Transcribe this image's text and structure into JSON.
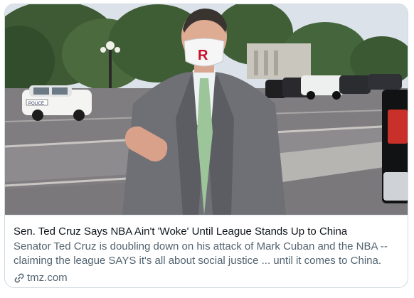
{
  "link_card": {
    "headline": "Sen. Ted Cruz Says NBA Ain't 'Woke' Until League Stands Up to China",
    "description": "Senator Ted Cruz is doubling down on his attack of Mark Cuban and the NBA -- claiming the league SAYS it's all about social justice ... until it comes to China.",
    "domain": "tmz.com",
    "source_icon": "link-icon",
    "police_car_text": "POLICE"
  },
  "colors": {
    "headline": "#0f1419",
    "secondary_text": "#536471",
    "border": "#cfd9de"
  }
}
